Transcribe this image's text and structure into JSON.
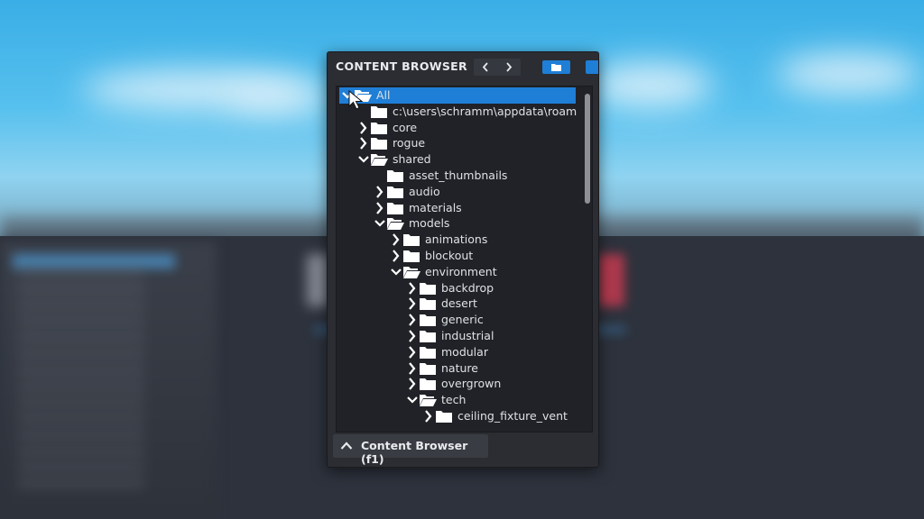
{
  "panel": {
    "title": "CONTENT BROWSER",
    "footer_label": "Content Browser (f1)",
    "accent_color": "#1f7ed6"
  },
  "tree": [
    {
      "label": "All",
      "depth": 0,
      "state": "open",
      "selected": true
    },
    {
      "label": "c:\\users\\schramm\\appdata\\roam",
      "depth": 1,
      "state": "leaf"
    },
    {
      "label": "core",
      "depth": 1,
      "state": "closed"
    },
    {
      "label": "rogue",
      "depth": 1,
      "state": "closed"
    },
    {
      "label": "shared",
      "depth": 1,
      "state": "open"
    },
    {
      "label": "asset_thumbnails",
      "depth": 2,
      "state": "leaf"
    },
    {
      "label": "audio",
      "depth": 2,
      "state": "closed"
    },
    {
      "label": "materials",
      "depth": 2,
      "state": "closed"
    },
    {
      "label": "models",
      "depth": 2,
      "state": "open"
    },
    {
      "label": "animations",
      "depth": 3,
      "state": "closed"
    },
    {
      "label": "blockout",
      "depth": 3,
      "state": "closed"
    },
    {
      "label": "environment",
      "depth": 3,
      "state": "open"
    },
    {
      "label": "backdrop",
      "depth": 4,
      "state": "closed"
    },
    {
      "label": "desert",
      "depth": 4,
      "state": "closed"
    },
    {
      "label": "generic",
      "depth": 4,
      "state": "closed"
    },
    {
      "label": "industrial",
      "depth": 4,
      "state": "closed"
    },
    {
      "label": "modular",
      "depth": 4,
      "state": "closed"
    },
    {
      "label": "nature",
      "depth": 4,
      "state": "closed"
    },
    {
      "label": "overgrown",
      "depth": 4,
      "state": "closed"
    },
    {
      "label": "tech",
      "depth": 4,
      "state": "open"
    },
    {
      "label": "ceiling_fixture_vent",
      "depth": 5,
      "state": "closed"
    }
  ],
  "icons": {
    "back": "chevron-left-icon",
    "forward": "chevron-right-icon",
    "folder_button": "folder-icon",
    "collapse": "chevron-up-icon"
  }
}
